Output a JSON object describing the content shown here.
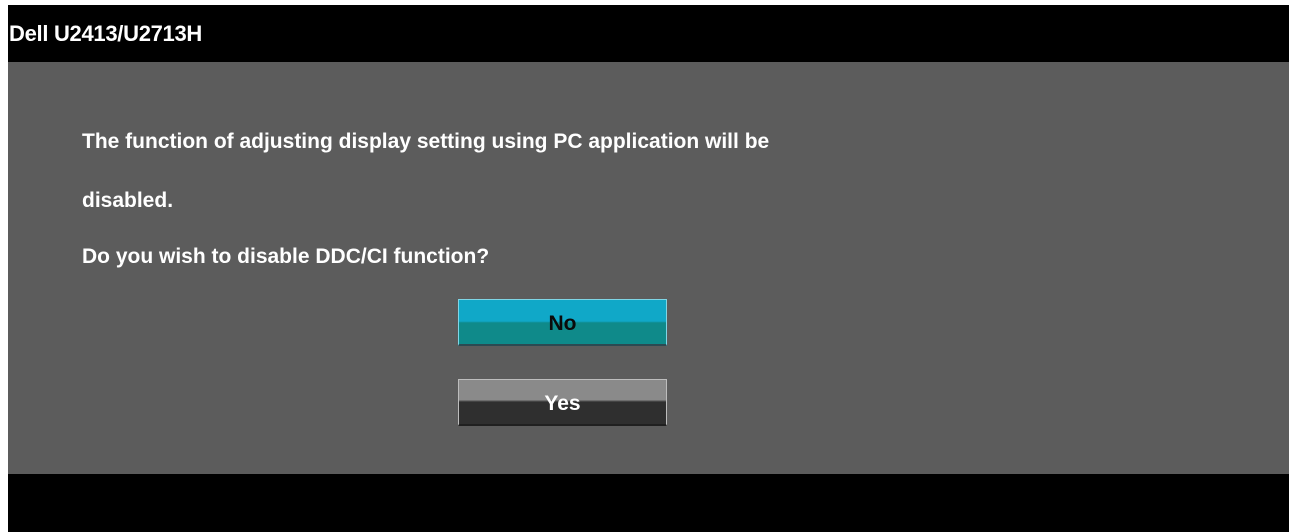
{
  "window": {
    "title": "Dell U2413/U2713H"
  },
  "dialog": {
    "message_lines": [
      "The function of adjusting display setting using PC application will be",
      "disabled.",
      "Do you wish to disable DDC/CI function?"
    ],
    "buttons": {
      "no_label": "No",
      "yes_label": "Yes",
      "selected": "No"
    }
  },
  "colors": {
    "background": "#000000",
    "panel": "#5c5c5c",
    "selected_button_top": "#10a8c8",
    "selected_button_bottom": "#0f8a8a",
    "text": "#ffffff"
  }
}
